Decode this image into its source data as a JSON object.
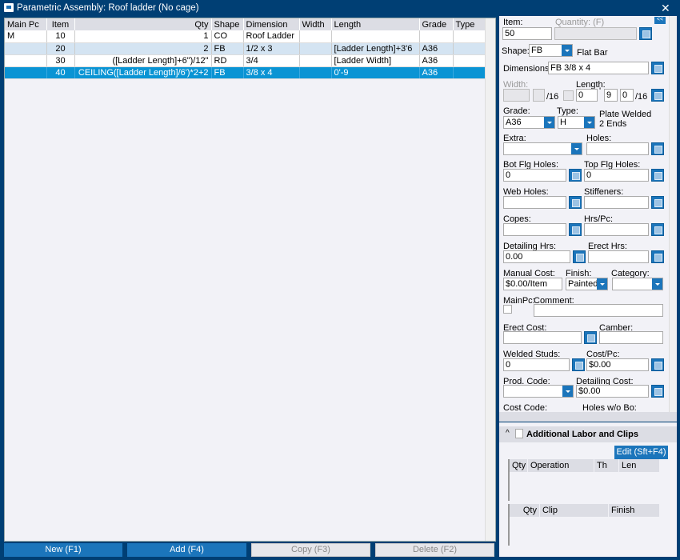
{
  "window": {
    "title": "Parametric Assembly: Roof ladder (No cage)",
    "close": "✕"
  },
  "grid": {
    "columns": [
      "Main Pc",
      "Item",
      "Qty",
      "Shape",
      "Dimension",
      "Width",
      "Length",
      "Grade",
      "Type"
    ],
    "rows": [
      [
        "M",
        "10",
        "1",
        "CO",
        "Roof Ladder",
        "",
        "",
        "",
        ""
      ],
      [
        "",
        "20",
        "2",
        "FB",
        "1/2 x 3",
        "",
        "[Ladder Length]+3'6",
        "A36",
        ""
      ],
      [
        "",
        "30",
        "([Ladder Length]+6\")/12\"",
        "RD",
        "3/4",
        "",
        "[Ladder Width]",
        "A36",
        ""
      ],
      [
        "",
        "40",
        "CEILING([Ladder Length]/6')*2+2",
        "FB",
        "3/8 x 4",
        "",
        "0'-9",
        "A36",
        ""
      ]
    ]
  },
  "buttons": {
    "new": "New (F1)",
    "add": "Add (F4)",
    "copy": "Copy (F3)",
    "delete": "Delete (F2)"
  },
  "form": {
    "collapse": "<<",
    "item_label": "Item:",
    "item": "50",
    "qty_label": "Quantity: (F)",
    "shape_label": "Shape:",
    "shape": "FB",
    "shape_desc": "Flat Bar",
    "dim_label": "Dimensions:",
    "dim": "FB 3/8 x 4",
    "width_label": "Width:",
    "sixteenth": "/16",
    "length_label": "Length:",
    "len_ft": "0",
    "len_tick": "'",
    "len_in": "9",
    "len_frac": "0",
    "grade_label": "Grade:",
    "grade": "A36",
    "type_label": "Type:",
    "type": "H",
    "type_desc": "Plate Welded 2 Ends",
    "extra_label": "Extra:",
    "holes_label": "Holes:",
    "bot_label": "Bot Flg Holes:",
    "bot": "0",
    "top_label": "Top Flg Holes:",
    "top": "0",
    "web_label": "Web Holes:",
    "stiff_label": "Stiffeners:",
    "copes_label": "Copes:",
    "hrs_label": "Hrs/Pc:",
    "det_hrs_label": "Detailing Hrs:",
    "det_hrs": "0.00",
    "erect_hrs_label": "Erect Hrs:",
    "manual_label": "Manual Cost:",
    "manual": "$0.00/Item",
    "finish_label": "Finish:",
    "finish": "Painted",
    "cat_label": "Category:",
    "mainpc_label": "MainPc:",
    "comment_label": "Comment:",
    "erect_cost_label": "Erect Cost:",
    "camber_label": "Camber:",
    "studs_label": "Welded Studs:",
    "studs": "0",
    "costpc_label": "Cost/Pc:",
    "costpc": "$0.00",
    "prod_label": "Prod. Code:",
    "detcost_label": "Detailing Cost:",
    "detcost": "$0.00",
    "costcode_label": "Cost Code:",
    "holeswo_label": "Holes w/o Bo:"
  },
  "labor": {
    "title": "Additional Labor and Clips",
    "edit": "Edit (Sft+F4)",
    "ops_cols": [
      "Qty",
      "Operation",
      "Th",
      "Len"
    ],
    "clip_cols": [
      "Qty",
      "Clip",
      "Finish"
    ]
  }
}
